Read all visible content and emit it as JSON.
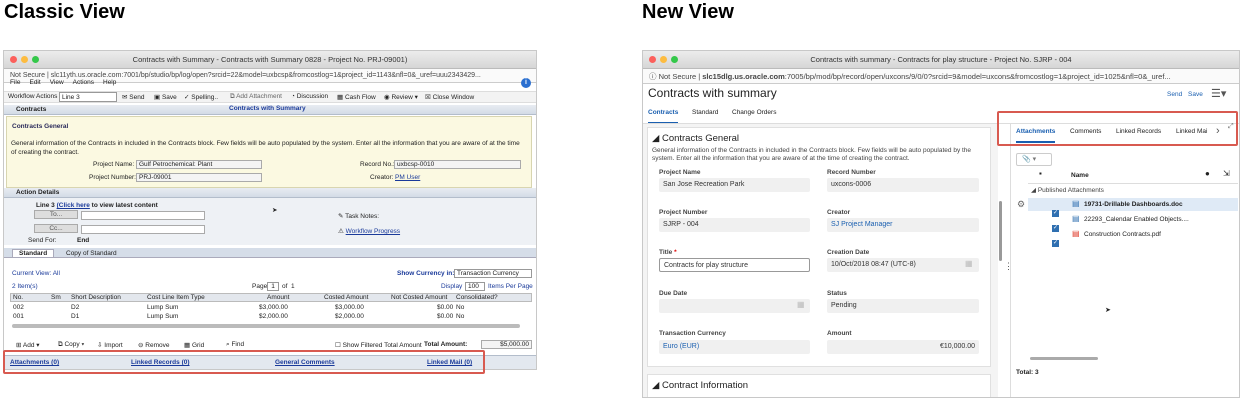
{
  "headers": {
    "classic": "Classic View",
    "new_view": "New View"
  },
  "classic": {
    "window_title": "Contracts with Summary - Contracts with Summary 0828 - Project No. PRJ-09001)",
    "address": "Not Secure | slc11yth.us.oracle.com:7001/bp/studio/bp/log/open?srcid=22&model=uxbcsp&fromcostlog=1&project_id=1143&nfl=0&_uref=uuu2343429...",
    "menu": [
      "File",
      "Edit",
      "View",
      "Actions",
      "Help"
    ],
    "toolbar": {
      "workflow_label": "Workflow Actions",
      "workflow_value": "Line 3",
      "send": "Send",
      "save": "Save",
      "spelling": "Spelling..",
      "add_attachment": "Add Attachment",
      "discussion": "Discussion",
      "cash_flow": "Cash Flow",
      "review": "Review",
      "close_window": "Close Window"
    },
    "form_title": "Contracts with Summary",
    "contracts_tab": "Contracts",
    "contracts_general_title": "Contracts General",
    "contracts_general_desc": "General information of the Contracts in included in the Contracts block. Few fields will be auto populated by the system. Enter all the information that you are aware of at the time of creating the contract.",
    "project_name_label": "Project Name:",
    "project_name": "Gulf Petrochemical: Plant",
    "project_number_label": "Project Number:",
    "project_number": "PRJ-09001",
    "record_no_label": "Record No.:",
    "record_no": "uxbcsp-0010",
    "creator_label": "Creator:",
    "creator": "PM User",
    "action_details": "Action Details",
    "line3_prefix": "Line 3",
    "click_here": "(Click here",
    "line3_suffix": " to view latest content",
    "to_btn": "To...",
    "cc_btn": "Cc...",
    "send_for_label": "Send For:",
    "send_for": "End",
    "task_notes": "Task Notes:",
    "workflow_progress": "Workflow Progress",
    "tabs": [
      "Standard",
      "Copy of Standard"
    ],
    "current_view": "Current View: All",
    "show_currency_label": "Show Currency in:",
    "show_currency": "Transaction Currency",
    "items_count": "2 Item(s)",
    "page_label": "Page",
    "page_num": "1",
    "of_label": "of",
    "page_total": "1",
    "display_label": "Display",
    "display_num": "100",
    "items_per_page": "Items Per Page",
    "table_headers": [
      "No.",
      "Sm",
      "Short Description",
      "Cost Line Item Type",
      "Amount",
      "Costed Amount",
      "Not Costed Amount",
      "Consolidated?"
    ],
    "table_rows": [
      [
        "002",
        "",
        "D2",
        "Lump Sum",
        "$3,000.00",
        "$3,000.00",
        "$0.00",
        "No"
      ],
      [
        "001",
        "",
        "D1",
        "Lump Sum",
        "$2,000.00",
        "$2,000.00",
        "$0.00",
        "No"
      ]
    ],
    "bottom_toolbar": [
      "Add",
      "Copy",
      "Import",
      "Remove",
      "Grid",
      "Find"
    ],
    "show_filtered": "Show Filtered Total Amount",
    "total_label": "Total Amount:",
    "total": "$5,000.00",
    "footer_links": [
      "Attachments (0)",
      "Linked Records (0)",
      "General Comments",
      "Linked Mail (0)"
    ]
  },
  "newv": {
    "window_title": "Contracts with summary - Contracts for play structure - Project No. SJRP - 004",
    "address_ns": "Not Secure",
    "address_host": "slc15dlg.us.oracle.com",
    "address_rest": ":7005/bp/mod/bp/record/open/uxcons/9/0/0?srcid=9&model=uxcons&fromcostlog=1&project_id=1025&nfl=0&_uref...",
    "title": "Contracts with summary",
    "send": "Send",
    "save": "Save",
    "tabs": [
      "Contracts",
      "Standard",
      "Change Orders"
    ],
    "section": "Contracts General",
    "desc": "General information of the Contracts in included in the Contracts block. Few fields will be auto populated by the system. Enter all the information that you are aware of at the time of creating the contract.",
    "fields": {
      "project_name_label": "Project Name",
      "project_name": "San Jose Recreation Park",
      "record_number_label": "Record Number",
      "record_number": "uxcons-0006",
      "project_number_label": "Project Number",
      "project_number": "SJRP - 004",
      "creator_label": "Creator",
      "creator": "SJ Project Manager",
      "title_label": "Title",
      "title": "Contracts for play structure",
      "creation_date_label": "Creation Date",
      "creation_date": "10/Oct/2018 08:47  (UTC-8)",
      "due_date_label": "Due Date",
      "status_label": "Status",
      "status": "Pending",
      "currency_label": "Transaction Currency",
      "currency": "Euro (EUR)",
      "amount_label": "Amount",
      "amount": "€10,000.00"
    },
    "section2": "Contract Information",
    "right_tabs": [
      "Attachments",
      "Comments",
      "Linked Records",
      "Linked Mai"
    ],
    "name_col": "Name",
    "published": "Published Attachments",
    "files": [
      "19731-Drillable Dashboards.doc",
      "22293_Calendar Enabled Objects....",
      "Construction Contracts.pdf"
    ],
    "total": "Total: 3"
  }
}
